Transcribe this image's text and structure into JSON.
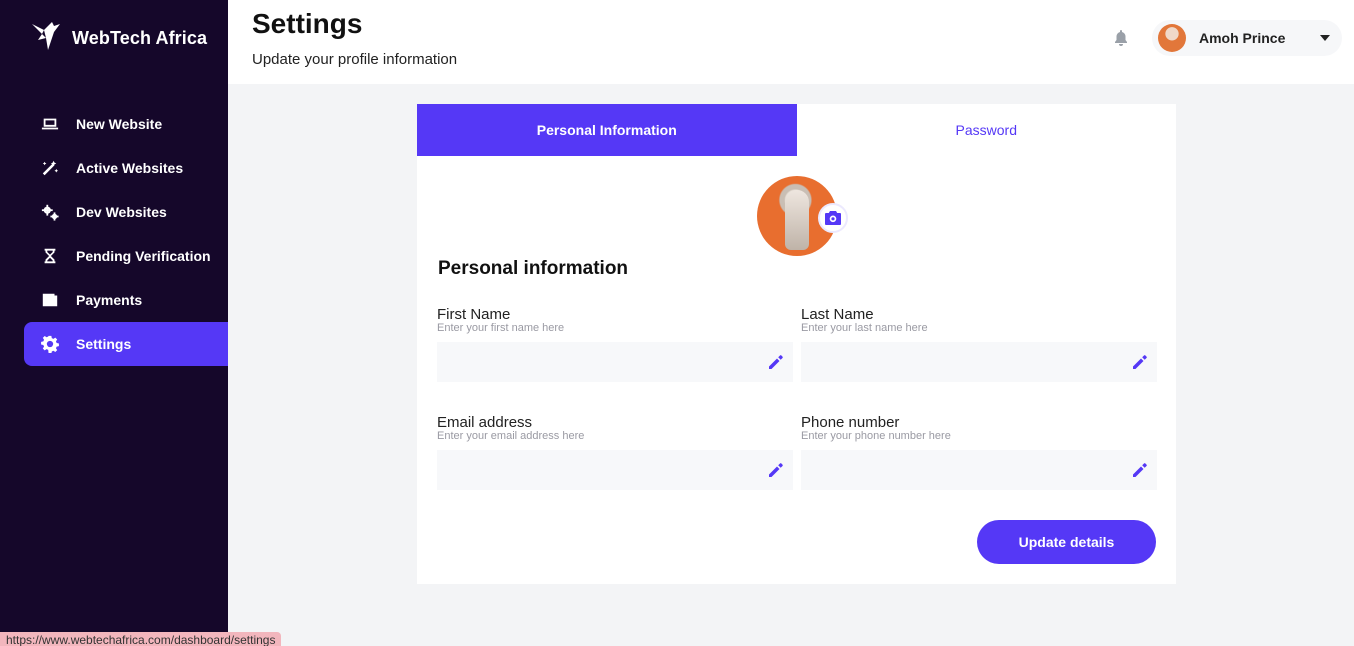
{
  "brand": {
    "name": "WebTech Africa"
  },
  "sidebar": {
    "items": [
      {
        "label": "New Website",
        "icon": "laptop-icon"
      },
      {
        "label": "Active Websites",
        "icon": "magic-wand-icon"
      },
      {
        "label": "Dev Websites",
        "icon": "gears-icon"
      },
      {
        "label": "Pending Verification",
        "icon": "hourglass-icon"
      },
      {
        "label": "Payments",
        "icon": "wallet-icon"
      },
      {
        "label": "Settings",
        "icon": "gear-icon",
        "active": true
      }
    ]
  },
  "header": {
    "title": "Settings",
    "subtitle": "Update your profile information",
    "user_name": "Amoh Prince"
  },
  "tabs": [
    {
      "label": "Personal Information",
      "active": true
    },
    {
      "label": "Password",
      "active": false
    }
  ],
  "form": {
    "section_title": "Personal information",
    "first_name": {
      "label": "First Name",
      "placeholder": "Enter your first name here",
      "value": ""
    },
    "last_name": {
      "label": "Last Name",
      "placeholder": "Enter your last name here",
      "value": ""
    },
    "email": {
      "label": "Email address",
      "placeholder": "Enter your email address here",
      "value": ""
    },
    "phone": {
      "label": "Phone number",
      "placeholder": "Enter your phone number here",
      "value": ""
    },
    "submit_label": "Update details"
  },
  "status_bar": {
    "url": "https://www.webtechafrica.com/dashboard/settings"
  },
  "colors": {
    "accent": "#5538f6",
    "sidebar_bg": "#15072a",
    "page_bg": "#f3f4f6"
  }
}
